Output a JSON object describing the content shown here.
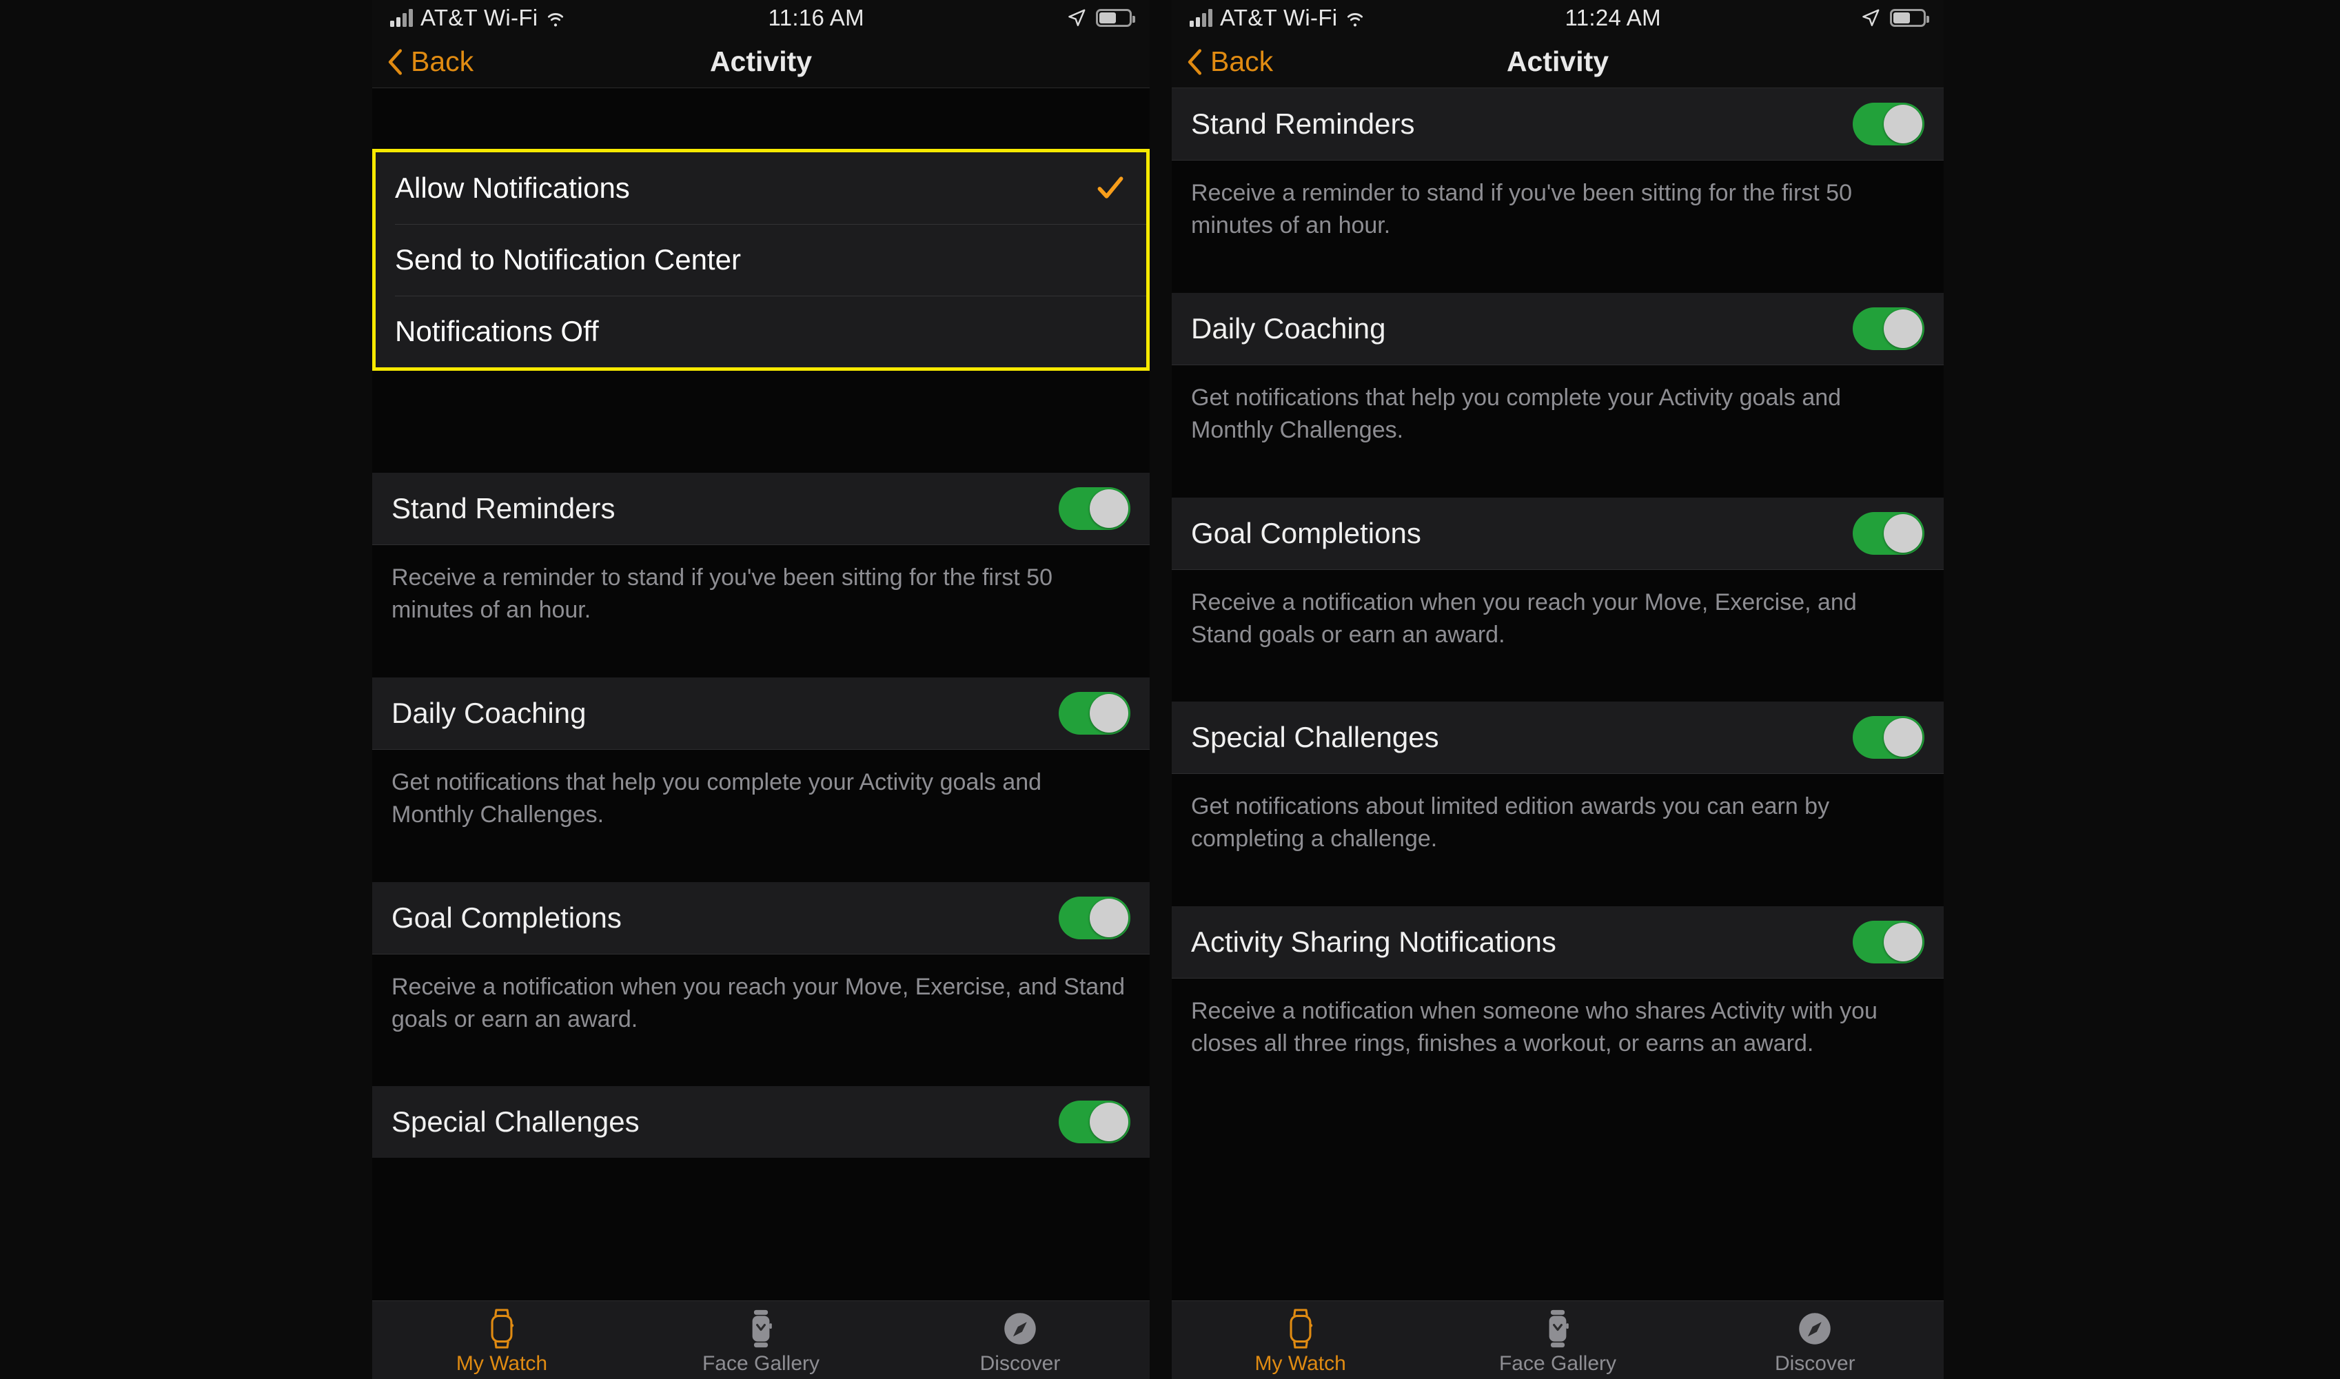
{
  "colors": {
    "accent_orange": "#e08b12",
    "highlight_yellow": "#f7e900",
    "toggle_green": "#22a13a",
    "row_bg": "#1c1c1e",
    "desc_bg": "#060606",
    "desc_text": "#8e8e93"
  },
  "panels": [
    {
      "id": "left",
      "status": {
        "carrier": "AT&T Wi-Fi",
        "time": "11:16 AM",
        "signal_icon": "signal-bars-icon",
        "wifi_icon": "wifi-icon",
        "location_icon": "location-arrow-icon",
        "battery_icon": "battery-icon"
      },
      "nav": {
        "back_label": "Back",
        "back_icon": "chevron-left-icon",
        "title": "Activity"
      },
      "options": {
        "highlighted": true,
        "items": [
          {
            "label": "Allow Notifications",
            "checked": true,
            "check_icon": "checkmark-icon"
          },
          {
            "label": "Send to Notification Center",
            "checked": false,
            "check_icon": ""
          },
          {
            "label": "Notifications Off",
            "checked": false,
            "check_icon": ""
          }
        ]
      },
      "settings": [
        {
          "label": "Stand Reminders",
          "toggle": "on",
          "description": "Receive a reminder to stand if you've been sitting for the first 50 minutes of an hour."
        },
        {
          "label": "Daily Coaching",
          "toggle": "on",
          "description": "Get notifications that help you complete your Activity goals and Monthly Challenges."
        },
        {
          "label": "Goal Completions",
          "toggle": "on",
          "description": "Receive a notification when you reach your Move, Exercise, and Stand goals or earn an award."
        },
        {
          "label": "Special Challenges",
          "toggle": "on",
          "description": ""
        }
      ],
      "tabs": [
        {
          "label": "My Watch",
          "icon": "watch-outline-icon",
          "active": true
        },
        {
          "label": "Face Gallery",
          "icon": "watch-face-icon",
          "active": false
        },
        {
          "label": "Discover",
          "icon": "compass-icon",
          "active": false
        }
      ]
    },
    {
      "id": "right",
      "status": {
        "carrier": "AT&T Wi-Fi",
        "time": "11:24 AM",
        "signal_icon": "signal-bars-icon",
        "wifi_icon": "wifi-icon",
        "location_icon": "location-arrow-icon",
        "battery_icon": "battery-icon"
      },
      "nav": {
        "back_label": "Back",
        "back_icon": "chevron-left-icon",
        "title": "Activity"
      },
      "settings": [
        {
          "label": "Stand Reminders",
          "toggle": "on",
          "description": "Receive a reminder to stand if you've been sitting for the first 50 minutes of an hour."
        },
        {
          "label": "Daily Coaching",
          "toggle": "on",
          "description": "Get notifications that help you complete your Activity goals and Monthly Challenges."
        },
        {
          "label": "Goal Completions",
          "toggle": "on",
          "description": "Receive a notification when you reach your Move, Exercise, and Stand goals or earn an award."
        },
        {
          "label": "Special Challenges",
          "toggle": "on",
          "description": "Get notifications about limited edition awards you can earn by completing a challenge."
        },
        {
          "label": "Activity Sharing Notifications",
          "toggle": "on",
          "description": "Receive a notification when someone who shares Activity with you closes all three rings, finishes a workout, or earns an award."
        }
      ],
      "tabs": [
        {
          "label": "My Watch",
          "icon": "watch-outline-icon",
          "active": true
        },
        {
          "label": "Face Gallery",
          "icon": "watch-face-icon",
          "active": false
        },
        {
          "label": "Discover",
          "icon": "compass-icon",
          "active": false
        }
      ]
    }
  ]
}
